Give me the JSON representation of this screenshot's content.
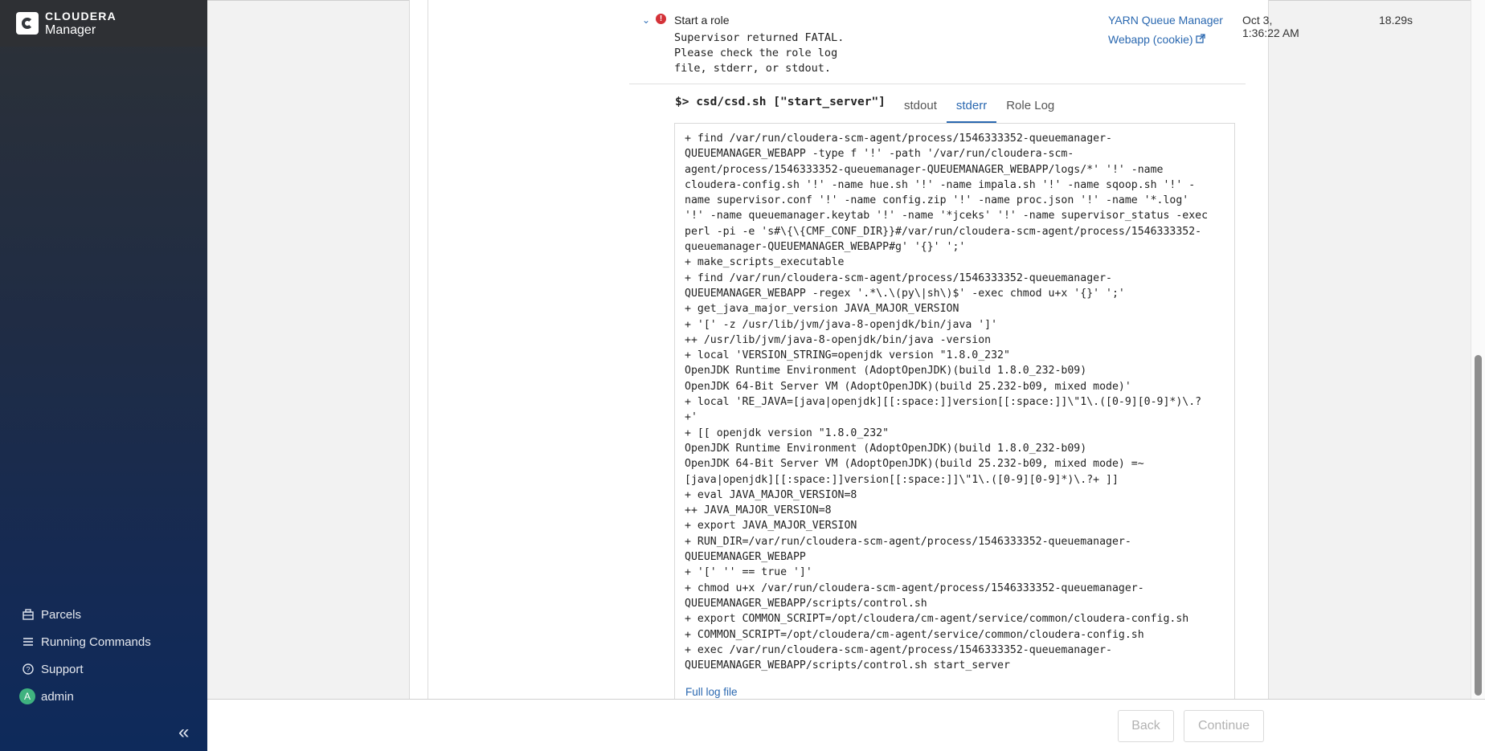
{
  "brand": {
    "top": "CLOUDERA",
    "bottom": "Manager"
  },
  "nav": [
    {
      "label": "Parcels",
      "icon": "parcels-icon"
    },
    {
      "label": "Running Commands",
      "icon": "running-commands-icon"
    },
    {
      "label": "Support",
      "icon": "support-icon"
    },
    {
      "label": "admin",
      "icon": "avatar",
      "avatar_letter": "A"
    }
  ],
  "collapse_glyph": "«",
  "step": {
    "title": "Start a role",
    "message": "Supervisor returned FATAL.\nPlease check the role log\nfile, stderr, or stdout.",
    "role_link": "YARN Queue Manager",
    "webapp_link": "Webapp (cookie)",
    "date": "Oct 3, 1:36:22 AM",
    "duration": "18.29s"
  },
  "command": {
    "prompt": "$>",
    "text": "csd/csd.sh [\"start_server\"]"
  },
  "tabs": [
    {
      "label": "stdout",
      "active": false
    },
    {
      "label": "stderr",
      "active": true
    },
    {
      "label": "Role Log",
      "active": false
    }
  ],
  "log_lines": [
    "+ find /var/run/cloudera-scm-agent/process/1546333352-queuemanager-",
    "QUEUEMANAGER_WEBAPP -type f '!' -path '/var/run/cloudera-scm-",
    "agent/process/1546333352-queuemanager-QUEUEMANAGER_WEBAPP/logs/*' '!' -name",
    "cloudera-config.sh '!' -name hue.sh '!' -name impala.sh '!' -name sqoop.sh '!' -",
    "name supervisor.conf '!' -name config.zip '!' -name proc.json '!' -name '*.log'",
    "'!' -name queuemanager.keytab '!' -name '*jceks' '!' -name supervisor_status -exec",
    "perl -pi -e 's#\\{\\{CMF_CONF_DIR}}#/var/run/cloudera-scm-agent/process/1546333352-",
    "queuemanager-QUEUEMANAGER_WEBAPP#g' '{}' ';'",
    "+ make_scripts_executable",
    "+ find /var/run/cloudera-scm-agent/process/1546333352-queuemanager-",
    "QUEUEMANAGER_WEBAPP -regex '.*\\.\\(py\\|sh\\)$' -exec chmod u+x '{}' ';'",
    "+ get_java_major_version JAVA_MAJOR_VERSION",
    "+ '[' -z /usr/lib/jvm/java-8-openjdk/bin/java ']'",
    "++ /usr/lib/jvm/java-8-openjdk/bin/java -version",
    "+ local 'VERSION_STRING=openjdk version \"1.8.0_232\"",
    "OpenJDK Runtime Environment (AdoptOpenJDK)(build 1.8.0_232-b09)",
    "OpenJDK 64-Bit Server VM (AdoptOpenJDK)(build 25.232-b09, mixed mode)'",
    "+ local 'RE_JAVA=[java|openjdk][[:space:]]version[[:space:]]\\\"1\\.([0-9][0-9]*)\\.?",
    "+'",
    "+ [[ openjdk version \"1.8.0_232\"",
    "OpenJDK Runtime Environment (AdoptOpenJDK)(build 1.8.0_232-b09)",
    "OpenJDK 64-Bit Server VM (AdoptOpenJDK)(build 25.232-b09, mixed mode) =~",
    "[java|openjdk][[:space:]]version[[:space:]]\\\"1\\.([0-9][0-9]*)\\.?+ ]]",
    "+ eval JAVA_MAJOR_VERSION=8",
    "++ JAVA_MAJOR_VERSION=8",
    "+ export JAVA_MAJOR_VERSION",
    "+ RUN_DIR=/var/run/cloudera-scm-agent/process/1546333352-queuemanager-",
    "QUEUEMANAGER_WEBAPP",
    "+ '[' '' == true ']'",
    "+ chmod u+x /var/run/cloudera-scm-agent/process/1546333352-queuemanager-",
    "QUEUEMANAGER_WEBAPP/scripts/control.sh",
    "+ export COMMON_SCRIPT=/opt/cloudera/cm-agent/service/common/cloudera-config.sh",
    "+ COMMON_SCRIPT=/opt/cloudera/cm-agent/service/common/cloudera-config.sh",
    "+ exec /var/run/cloudera-scm-agent/process/1546333352-queuemanager-",
    "QUEUEMANAGER_WEBAPP/scripts/control.sh start_server"
  ],
  "full_log_link": "Full log file",
  "footer": {
    "back": "Back",
    "continue": "Continue"
  },
  "colors": {
    "link": "#2a68b0",
    "error": "#d43238",
    "avatar": "#3fb27f"
  }
}
